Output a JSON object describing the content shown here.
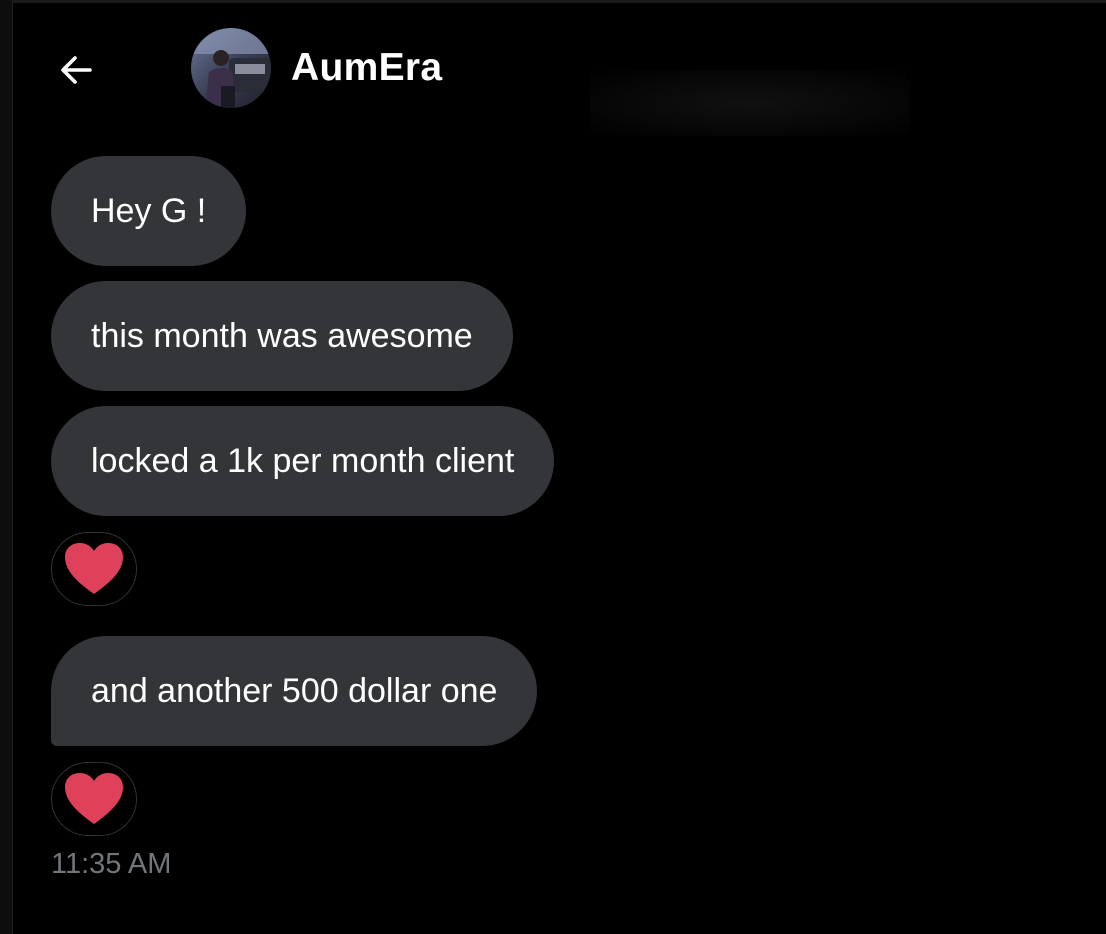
{
  "header": {
    "contact_name": "AumEra",
    "back_icon": "arrow-left-icon"
  },
  "messages": [
    {
      "text": "Hey G !"
    },
    {
      "text": "this month was awesome"
    },
    {
      "text": "locked a 1k per month client",
      "reaction": "heart-icon"
    },
    {
      "text": "and another 500 dollar one",
      "reaction": "heart-icon"
    }
  ],
  "timestamp": "11:35 AM",
  "colors": {
    "background": "#000000",
    "bubble": "#333539",
    "heart": "#e0415a",
    "timestamp": "#71767b"
  }
}
